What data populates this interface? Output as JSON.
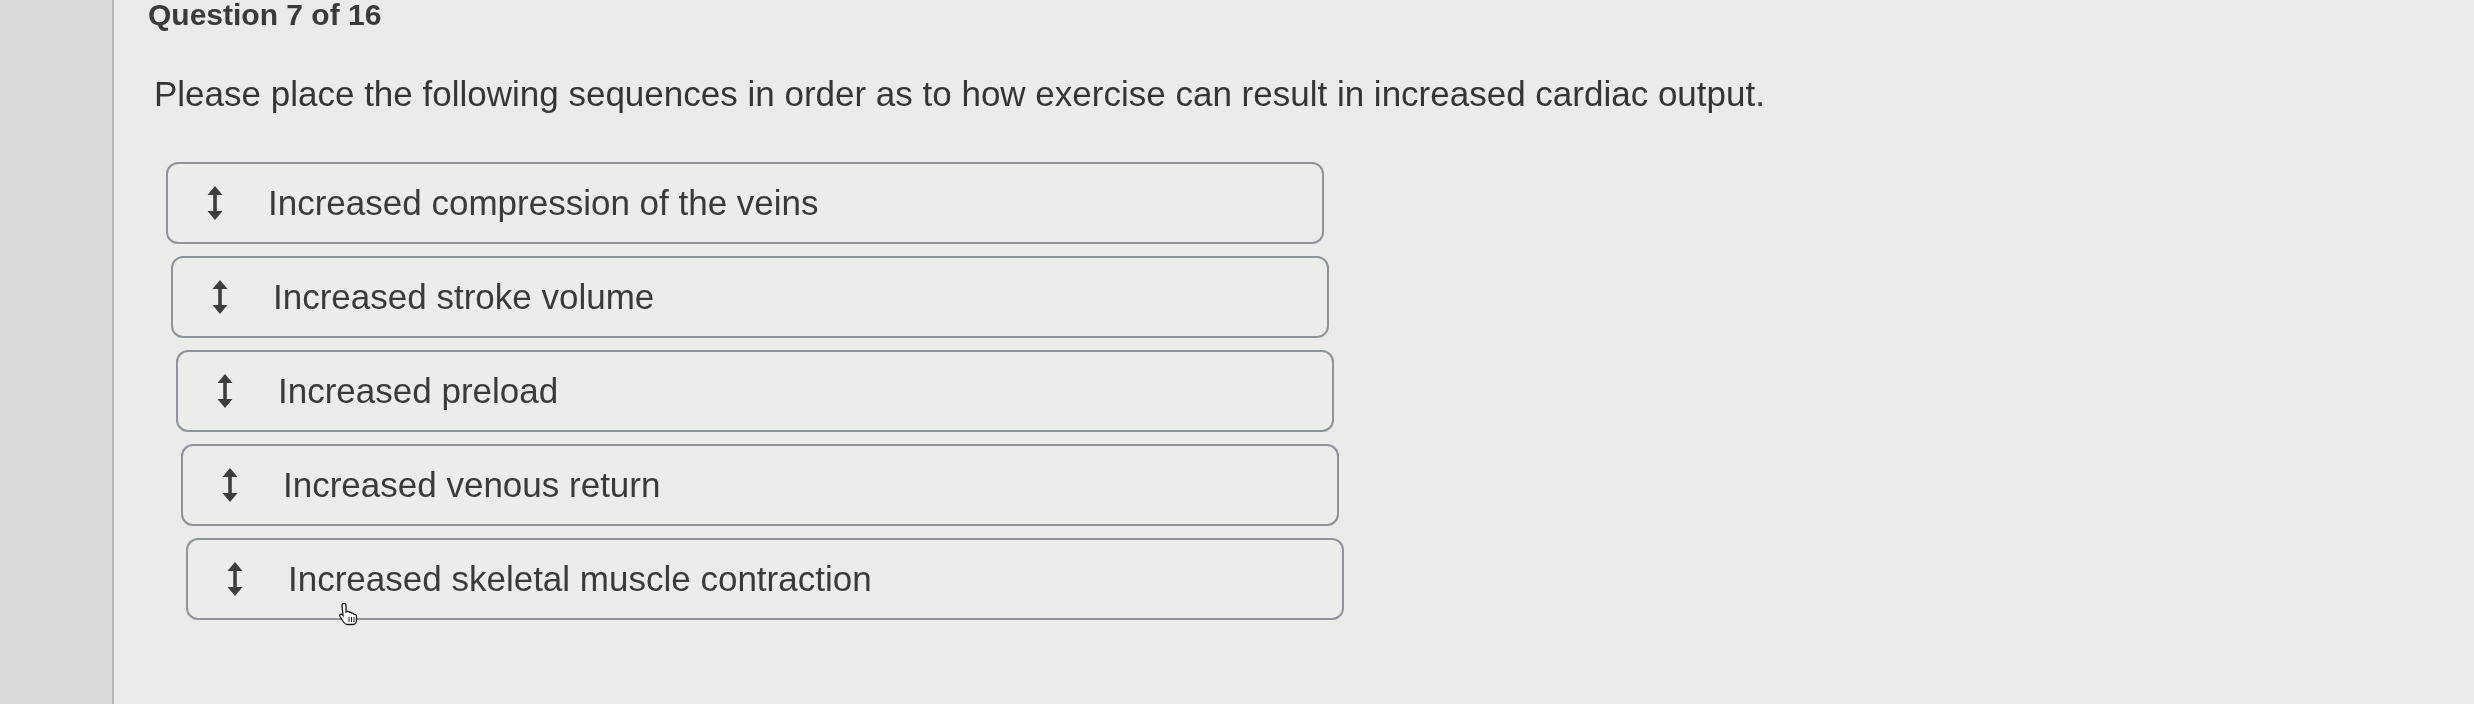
{
  "header": {
    "question_counter": "Question 7 of 16"
  },
  "question": {
    "prompt": "Please place the following sequences in order as to how exercise can result in increased cardiac output."
  },
  "sequence_items": [
    {
      "label": "Increased compression of the veins"
    },
    {
      "label": "Increased stroke volume"
    },
    {
      "label": "Increased preload"
    },
    {
      "label": "Increased venous return"
    },
    {
      "label": "Increased skeletal muscle contraction",
      "pointer_over": true
    }
  ]
}
